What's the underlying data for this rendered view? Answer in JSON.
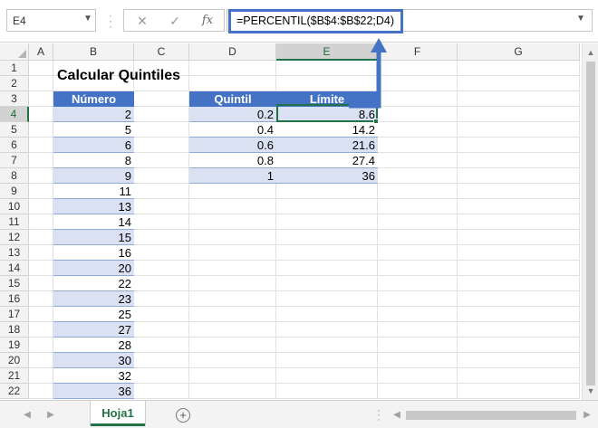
{
  "name_box": "E4",
  "formula": "=PERCENTIL($B$4:$B$22;D4)",
  "formula_bar": {
    "cancel_glyph": "✕",
    "enter_glyph": "✓",
    "fx_glyph": "fx"
  },
  "columns": [
    "A",
    "B",
    "C",
    "D",
    "E",
    "F",
    "G"
  ],
  "selected_column": "E",
  "rows": [
    "1",
    "2",
    "3",
    "4",
    "5",
    "6",
    "7",
    "8",
    "9",
    "10",
    "11",
    "12",
    "13",
    "14",
    "15",
    "16",
    "17",
    "18",
    "19",
    "20",
    "21",
    "22"
  ],
  "selected_row": "4",
  "title": "Calcular Quintiles",
  "numero_table": {
    "header": "Número",
    "values": [
      "2",
      "5",
      "6",
      "8",
      "9",
      "11",
      "13",
      "14",
      "15",
      "16",
      "20",
      "22",
      "23",
      "25",
      "27",
      "28",
      "30",
      "32",
      "36"
    ]
  },
  "quintile_table": {
    "headers": [
      "Quintil",
      "Límite"
    ],
    "rows": [
      [
        "0.2",
        "8.6"
      ],
      [
        "0.4",
        "14.2"
      ],
      [
        "0.6",
        "21.6"
      ],
      [
        "0.8",
        "27.4"
      ],
      [
        "1",
        "36"
      ]
    ]
  },
  "sheet_tab": "Hoja1",
  "colors": {
    "table_header": "#4472c4",
    "band": "#d9e1f2",
    "selection": "#217346",
    "arrow": "#4472c4"
  }
}
